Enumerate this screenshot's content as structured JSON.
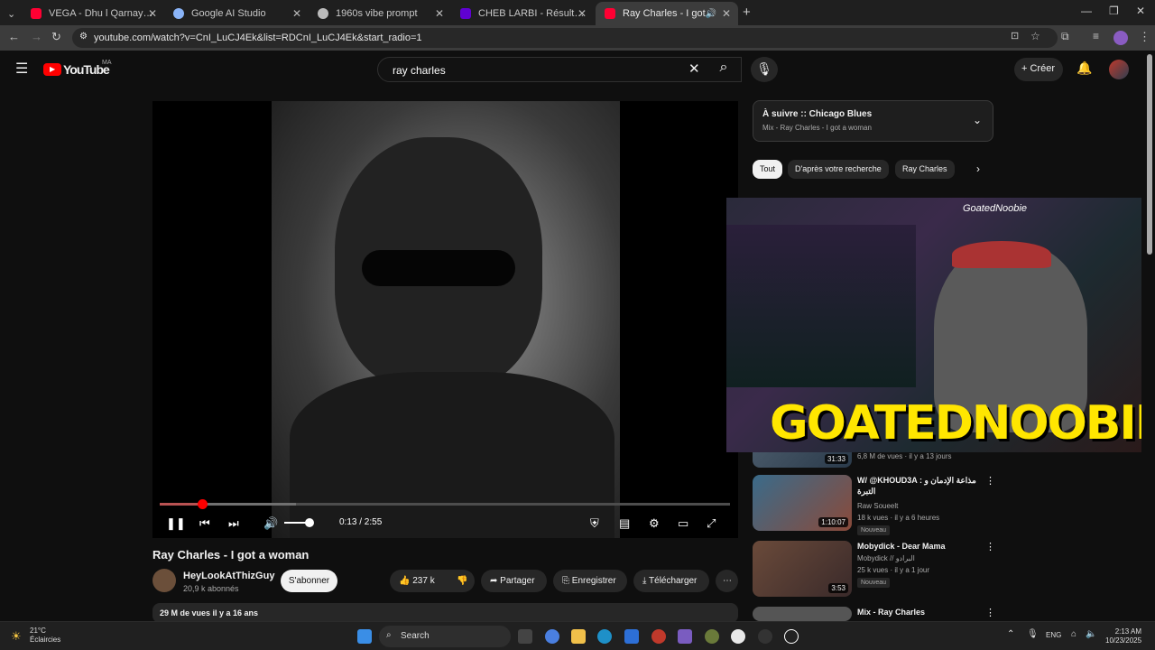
{
  "browser": {
    "tabs": [
      {
        "label": "VEGA - Dhu l Qarnayn Prod By",
        "favicon_color": "#ff0033"
      },
      {
        "label": "Google AI Studio",
        "favicon_color": "#8ab4f8"
      },
      {
        "label": "1960s vibe prompt",
        "favicon_color": "#bbbbbb"
      },
      {
        "label": "CHEB LARBI - Résultats Yahoo",
        "favicon_color": "#6001d2"
      },
      {
        "label": "Ray Charles - I got a woman",
        "favicon_color": "#ff0033",
        "active": true
      }
    ],
    "url": "youtube.com/watch?v=CnI_LuCJ4Ek&list=RDCnI_LuCJ4Ek&start_radio=1"
  },
  "youtube": {
    "logo_text": "YouTube",
    "region": "MA",
    "search_value": "ray charles",
    "create_label": "Créer"
  },
  "player": {
    "time": "0:13 / 2:55",
    "progress_fraction": 0.074,
    "volume_fraction": 0.5
  },
  "video": {
    "title": "Ray Charles - I got a woman",
    "channel": "HeyLookAtThizGuy",
    "subscribers": "20,9 k abonnés",
    "subscribe_label": "S'abonner",
    "likes": "237 k",
    "share_label": "Partager",
    "save_label": "Enregistrer",
    "download_label": "Télécharger",
    "views_date": "29 M de vues  il y a 16 ans"
  },
  "upnext": {
    "title": "À suivre :: Chicago Blues",
    "subtitle": "Mix - Ray Charles - I got a woman"
  },
  "chips": [
    "Tout",
    "D'après votre recherche",
    "Ray Charles"
  ],
  "overlay": {
    "tag": "GoatedNoobie",
    "title": "GOATEDNOOBIE"
  },
  "recommended": [
    {
      "title": "",
      "channel": "",
      "meta": "6,8 M de vues · il y a 13 jours",
      "duration": "31:33",
      "new": ""
    },
    {
      "title": "W/ @KHOUD3A : مذاعة الإدمان و التبرة",
      "channel": "Raw Soueelt",
      "meta": "18 k vues · il y a 6 heures",
      "duration": "1:10:07",
      "new": "Nouveau"
    },
    {
      "title": "Mobydick - Dear Mama",
      "channel": "Mobydick // البرادو",
      "meta": "25 k vues · il y a 1 jour",
      "duration": "3:53",
      "new": "Nouveau"
    },
    {
      "title": "Mix - Ray Charles",
      "channel": "",
      "meta": "",
      "duration": "",
      "new": ""
    }
  ],
  "taskbar": {
    "temp": "21°C",
    "weather": "Éclaircies",
    "search_placeholder": "Search",
    "lang": "ENG",
    "time": "2:13 AM",
    "date": "10/23/2025"
  }
}
